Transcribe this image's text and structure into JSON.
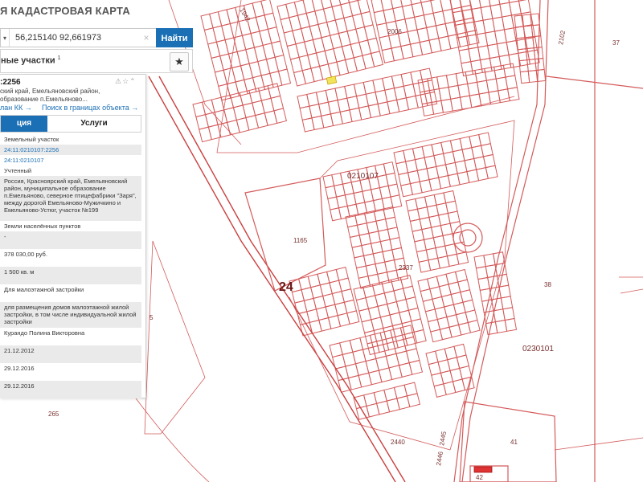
{
  "header": {
    "title": "Я КАДАСТРОВАЯ КАРТА"
  },
  "search": {
    "value": "56,215140 92,661973",
    "button_label": "Найти",
    "dropdown_icon": "chevron-down-icon",
    "clear_icon": "close-icon"
  },
  "section": {
    "title": "ные участки",
    "count": "1",
    "star_icon": "star-icon"
  },
  "object": {
    "id": ":2256",
    "address_lines": [
      "ский край, Емельяновский район,",
      "образование п.Емельяново..."
    ],
    "links": {
      "plan": "лан КК →",
      "search_in_bounds": "Поиск в границах объекта →"
    },
    "tabs": {
      "info": "ция",
      "services": "Услуги"
    },
    "rows": [
      {
        "text": "Земельный участок",
        "shade": false,
        "link": false,
        "h": 13
      },
      {
        "text": "24:11:0210107:2256",
        "shade": true,
        "link": true,
        "h": 13
      },
      {
        "text": "24:11:0210107",
        "shade": false,
        "link": true,
        "h": 13
      },
      {
        "text": "Учтенный",
        "shade": false,
        "link": false,
        "h": 13
      },
      {
        "text": "Россия, Красноярский край, Емельяновский район, муниципальное образование п.Емельяново, северное птицефабрики \"Заря\", между дорогой Емельяново-Мужичкино и Емельяново-Устюг, участок №199",
        "shade": true,
        "link": false,
        "h": 56
      },
      {
        "text": "Земли населённых пунктов",
        "shade": false,
        "link": false,
        "h": 13
      },
      {
        "text": "-",
        "shade": true,
        "link": false,
        "h": 22
      },
      {
        "text": "378 030,00 руб.",
        "shade": false,
        "link": false,
        "h": 22
      },
      {
        "text": "1 500 кв. м",
        "shade": true,
        "link": false,
        "h": 22
      },
      {
        "text": "Для малоэтажной застройки",
        "shade": false,
        "link": false,
        "h": 22
      },
      {
        "text": "для размещения домов малоэтажной жилой застройки, в том числе индивидуальной жилой застройки",
        "shade": true,
        "link": false,
        "h": 32
      },
      {
        "text": "Курандо Полина Викторовна",
        "shade": false,
        "link": false,
        "h": 22
      },
      {
        "text": "21.12.2012",
        "shade": true,
        "link": false,
        "h": 22
      },
      {
        "text": "29.12.2016",
        "shade": false,
        "link": false,
        "h": 22
      },
      {
        "text": "29.12.2016",
        "shade": true,
        "link": false,
        "h": 22
      }
    ],
    "icons": [
      "warning-icon",
      "star-outline-icon",
      "chevron-up-icon"
    ]
  },
  "map": {
    "labels": {
      "l1942": "1942",
      "l2006": "2006",
      "l2102": "2102",
      "l37": "37",
      "l0210107": "0210107",
      "l1165": "1165",
      "l2337": "2337",
      "l24": "24",
      "l38": "38",
      "l0230101": "0230101",
      "l265": "265",
      "l2440": "2440",
      "l2445": "2445",
      "l2446": "2446",
      "l41": "41",
      "l42": "42",
      "l5": "5"
    },
    "colors": {
      "boundary": "#d45a5a",
      "highlight": "#f2e35c",
      "road": "#c94040"
    }
  }
}
